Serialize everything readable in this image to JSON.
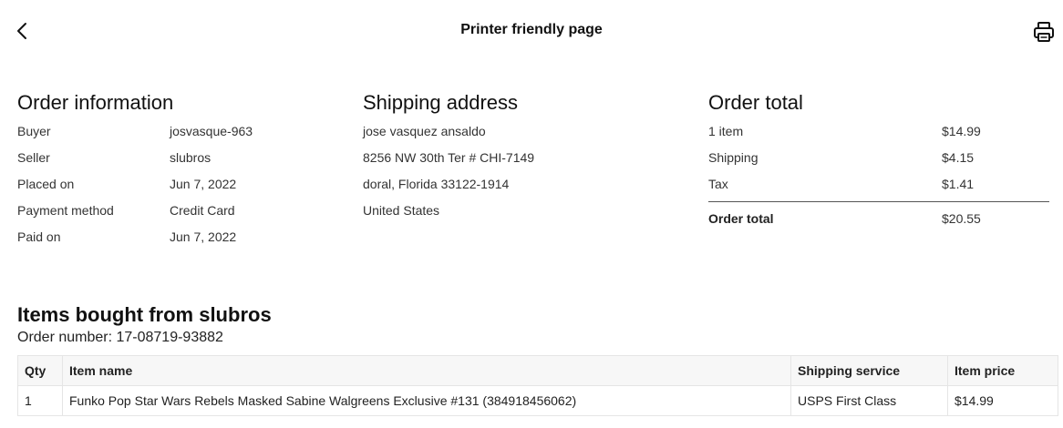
{
  "header": {
    "title": "Printer friendly page",
    "back_icon": "chevron-left-icon",
    "print_icon": "printer-icon"
  },
  "order_info": {
    "heading": "Order information",
    "rows": [
      {
        "label": "Buyer",
        "value": "josvasque-963"
      },
      {
        "label": "Seller",
        "value": "slubros"
      },
      {
        "label": "Placed on",
        "value": "Jun 7, 2022"
      },
      {
        "label": "Payment method",
        "value": "Credit Card"
      },
      {
        "label": "Paid on",
        "value": "Jun 7, 2022"
      }
    ]
  },
  "shipping_address": {
    "heading": "Shipping address",
    "lines": [
      "jose vasquez ansaldo",
      "8256 NW 30th Ter # CHI-7149",
      "doral, Florida 33122-1914",
      "United States"
    ]
  },
  "order_total": {
    "heading": "Order total",
    "rows": [
      {
        "label": "1 item",
        "value": "$14.99"
      },
      {
        "label": "Shipping",
        "value": "$4.15"
      },
      {
        "label": "Tax",
        "value": "$1.41"
      }
    ],
    "total_label": "Order total",
    "total_value": "$20.55"
  },
  "items": {
    "heading": "Items bought from slubros",
    "order_number": "Order number: 17-08719-93882",
    "columns": [
      "Qty",
      "Item name",
      "Shipping service",
      "Item price"
    ],
    "rows": [
      {
        "qty": "1",
        "name": "Funko Pop Star Wars Rebels Masked Sabine Walgreens Exclusive #131 (384918456062)",
        "shipping": "USPS First Class",
        "price": "$14.99"
      }
    ]
  }
}
